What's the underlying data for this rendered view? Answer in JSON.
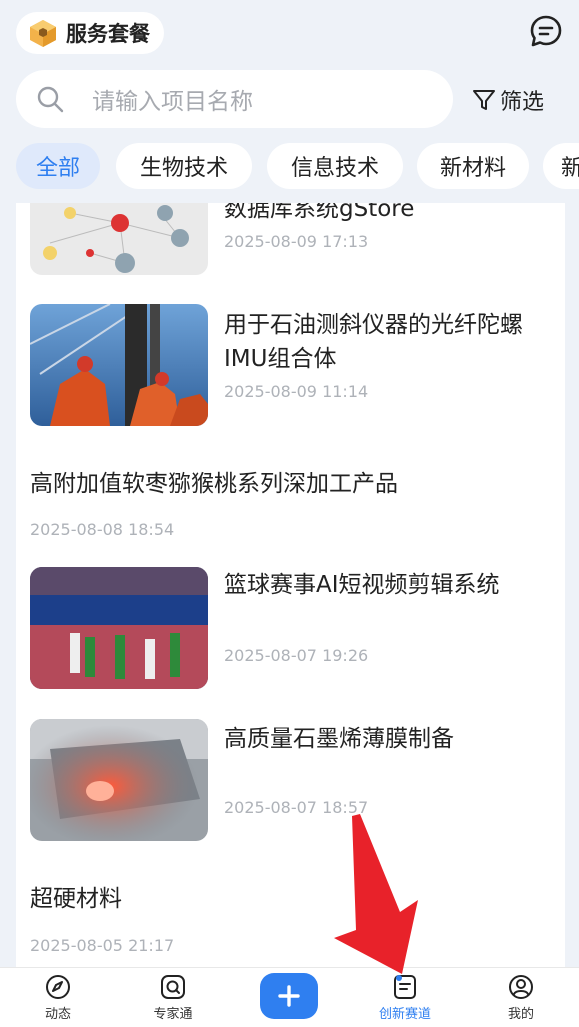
{
  "header": {
    "plan_label": "服务套餐"
  },
  "search": {
    "placeholder": "请输入项目名称",
    "filter_label": "筛选"
  },
  "tabs": [
    {
      "label": "全部",
      "active": true
    },
    {
      "label": "生物技术"
    },
    {
      "label": "信息技术"
    },
    {
      "label": "新材料"
    },
    {
      "label": "新"
    }
  ],
  "items": [
    {
      "title": "数据库系统gStore",
      "date": "2025-08-09 17:13",
      "thumb": "graph-map"
    },
    {
      "title": "用于石油测斜仪器的光纤陀螺IMU组合体",
      "date": "2025-08-09 11:14",
      "thumb": "oil-drill-workers"
    },
    {
      "title": "高附加值软枣猕猴桃系列深加工产品",
      "date": "2025-08-08 18:54"
    },
    {
      "title": "篮球赛事AI短视频剪辑系统",
      "date": "2025-08-07 19:26",
      "thumb": "basketball-game"
    },
    {
      "title": "高质量石墨烯薄膜制备",
      "date": "2025-08-07 18:57",
      "thumb": "furnace-tube"
    },
    {
      "title": "超硬材料",
      "date": "2025-08-05 21:17"
    }
  ],
  "nav": [
    {
      "label": "动态",
      "icon": "compass-icon"
    },
    {
      "label": "专家通",
      "icon": "expert-icon"
    },
    {
      "label": "",
      "icon": "plus-icon"
    },
    {
      "label": "创新赛道",
      "icon": "document-icon",
      "active": true
    },
    {
      "label": "我的",
      "icon": "user-icon"
    }
  ],
  "colors": {
    "accent": "#2f7ff0",
    "background": "#eef2f8",
    "arrow": "#e8222a"
  }
}
